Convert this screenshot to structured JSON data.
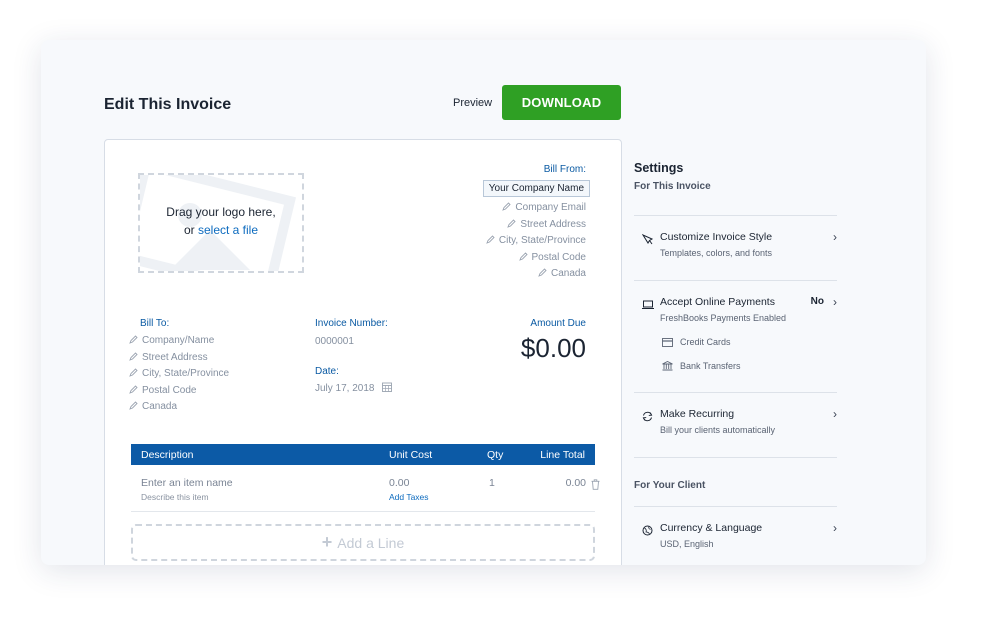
{
  "page": {
    "title": "Edit This Invoice",
    "preview_label": "Preview",
    "download_label": "DOWNLOAD"
  },
  "logo_upload": {
    "line1": "Drag your logo here,",
    "line2_prefix": "or ",
    "link_text": "select a file"
  },
  "bill_from": {
    "title": "Bill From:",
    "company_name": "Your Company Name",
    "fields": [
      "Company Email",
      "Street Address",
      "City, State/Province",
      "Postal Code",
      "Canada"
    ]
  },
  "bill_to": {
    "title": "Bill To:",
    "fields": [
      "Company/Name",
      "Street Address",
      "City, State/Province",
      "Postal Code",
      "Canada"
    ]
  },
  "invoice_number": {
    "label": "Invoice Number:",
    "value": "0000001"
  },
  "date": {
    "label": "Date:",
    "value": "July 17, 2018"
  },
  "amount_due": {
    "label": "Amount Due",
    "value": "$0.00"
  },
  "line_items": {
    "headers": {
      "description": "Description",
      "unit_cost": "Unit Cost",
      "qty": "Qty",
      "line_total": "Line Total"
    },
    "rows": [
      {
        "name": "Enter an item name",
        "description": "Describe this item",
        "unit_cost": "0.00",
        "add_taxes": "Add Taxes",
        "qty": "1",
        "line_total": "0.00"
      }
    ],
    "add_line": "Add a Line"
  },
  "settings": {
    "title": "Settings",
    "section_invoice": "For This Invoice",
    "customize": {
      "label": "Customize Invoice Style",
      "desc": "Templates, colors, and fonts"
    },
    "payments": {
      "label": "Accept Online Payments",
      "status": "No",
      "desc": "FreshBooks Payments Enabled",
      "credit_cards": "Credit Cards",
      "bank_transfers": "Bank Transfers"
    },
    "recurring": {
      "label": "Make Recurring",
      "desc": "Bill your clients automatically"
    },
    "section_client": "For Your Client",
    "currency": {
      "label": "Currency & Language",
      "desc": "USD, English"
    }
  },
  "colors": {
    "accent": "#0c5aa6",
    "download": "#2fa024",
    "link": "#0d6bbf"
  }
}
